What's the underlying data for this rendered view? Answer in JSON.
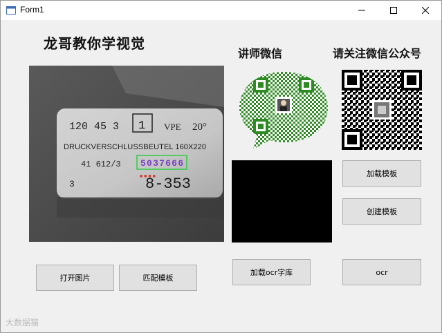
{
  "window": {
    "title": "Form1"
  },
  "headings": {
    "main": "龙哥教你学视觉",
    "teacher_wechat": "讲师微信",
    "follow_account": "请关注微信公众号"
  },
  "image": {
    "label_lines": [
      "120  45 3",
      "1",
      "VPE",
      "20°",
      "DRUCKVERSCHLUSSBEUTEL 160X220",
      "41 612/3",
      "5037666",
      "3",
      "8-353"
    ]
  },
  "buttons": {
    "open_image": "打开图片",
    "match_template": "匹配模板",
    "load_ocr_library": "加载ocr字库",
    "ocr": "ocr",
    "load_template": "加载模板",
    "create_template": "创建模板"
  },
  "watermark": "大数据猫",
  "colors": {
    "window_bg": "#f0f0f0",
    "button_bg": "#e1e1e1",
    "button_border": "#adadad",
    "focus_border": "#0078d7",
    "qr_green": "#2e8b23",
    "match_box": "#2ecc40"
  }
}
